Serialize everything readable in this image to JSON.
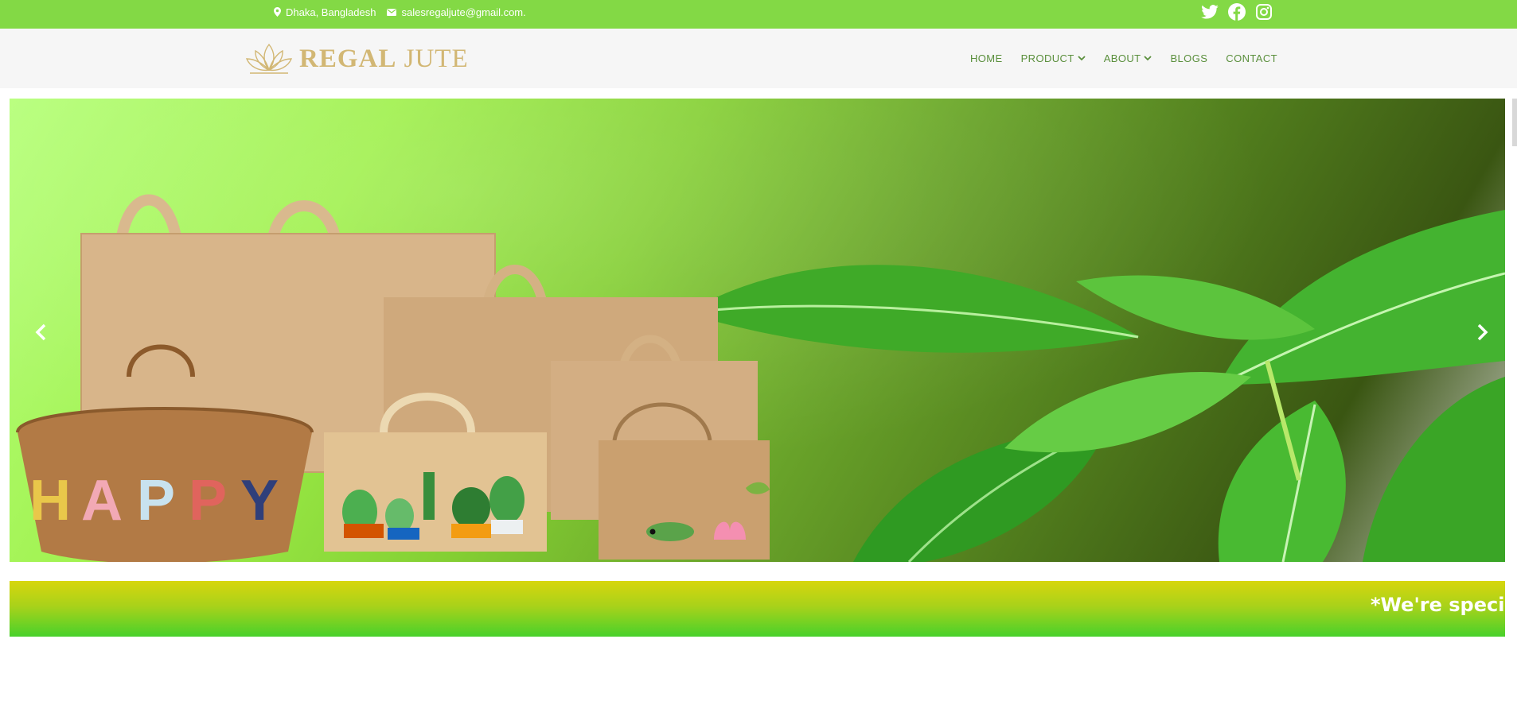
{
  "topbar": {
    "location": "Dhaka, Bangladesh",
    "email": "salesregaljute@gmail.com.",
    "social": [
      "twitter-icon",
      "facebook-icon",
      "instagram-icon"
    ]
  },
  "header": {
    "logo_bold": "REGAL",
    "logo_light": "JUTE",
    "nav": [
      {
        "label": "HOME",
        "dropdown": false
      },
      {
        "label": "PRODUCT",
        "dropdown": true
      },
      {
        "label": "ABOUT",
        "dropdown": true
      },
      {
        "label": "BLOGS",
        "dropdown": false
      },
      {
        "label": "CONTACT",
        "dropdown": false
      }
    ]
  },
  "hero": {
    "bag_letters": [
      "H",
      "A",
      "P",
      "P",
      "Y"
    ],
    "prev_icon": "chevron-left-icon",
    "next_icon": "chevron-right-icon"
  },
  "banner": {
    "text": "*We're speciali"
  },
  "colors": {
    "topbar": "#83d945",
    "nav_text": "#5a8f3c",
    "logo_gold": "#d2b774",
    "banner_top": "#d7d60d",
    "banner_bottom": "#48d12b"
  }
}
